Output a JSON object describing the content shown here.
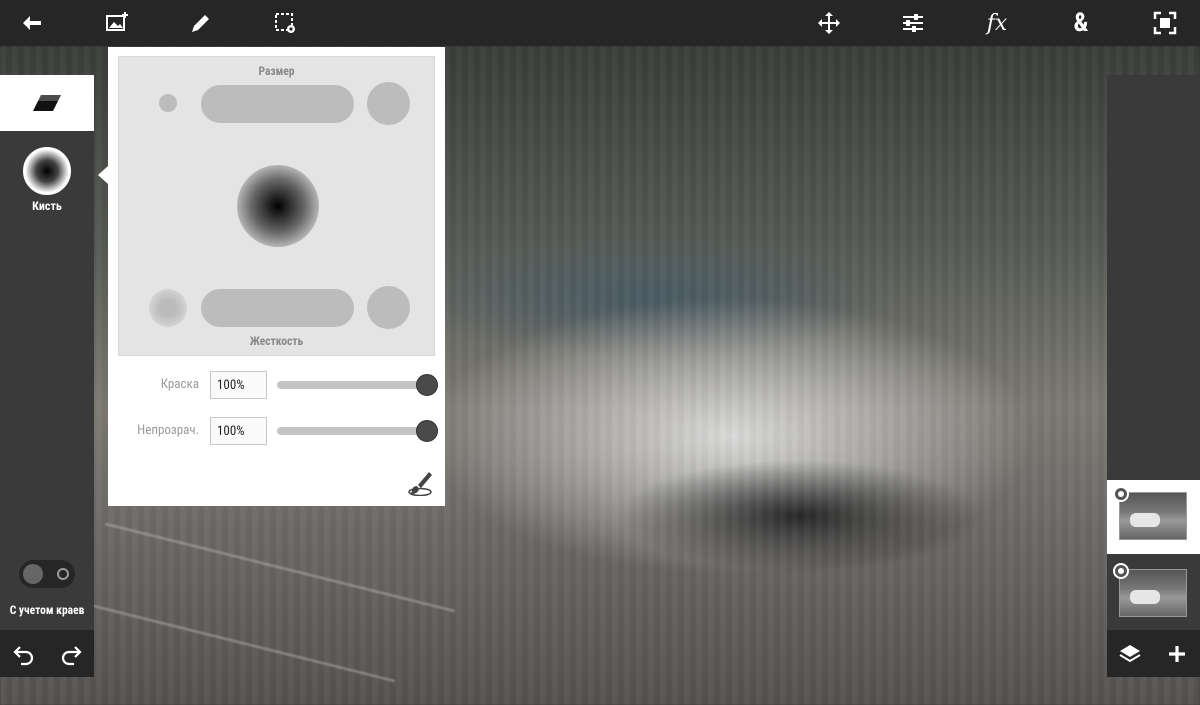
{
  "app": {
    "toolbar": {
      "icons": [
        "back-arrow-icon",
        "add-image-icon",
        "pencil-icon",
        "selection-settings-icon",
        "move-icon",
        "adjustments-icon",
        "fx-icon",
        "blend-icon",
        "fit-screen-icon"
      ],
      "fx_label": "fx",
      "blend_label": "&"
    },
    "left_panel": {
      "tool_label": "Кисть",
      "edge_toggle_label": "С учетом краев",
      "edge_toggle_on": false
    },
    "brush_popup": {
      "size_label": "Размер",
      "hardness_label": "Жесткость",
      "paint": {
        "label": "Краска",
        "value": "100%",
        "percent": 100
      },
      "opacity": {
        "label": "Непрозрач.",
        "value": "100%",
        "percent": 100
      }
    },
    "layers": [
      {
        "selected": true
      },
      {
        "selected": false
      }
    ]
  }
}
